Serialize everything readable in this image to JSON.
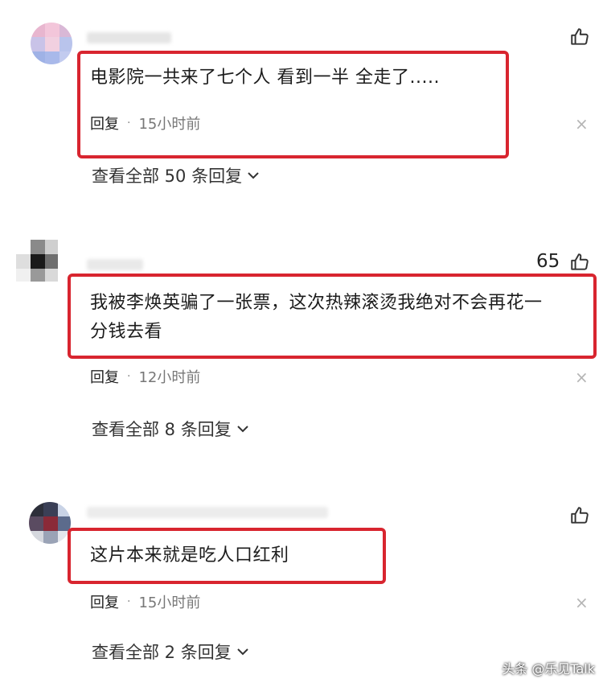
{
  "comments": [
    {
      "text": "电影院一共来了七个人 看到一半 全走了.....",
      "reply_label": "回复",
      "separator": "·",
      "time": "15小时前",
      "view_replies": "查看全部 50 条回复",
      "likes": "",
      "close": "×"
    },
    {
      "text_line1": "我被李焕英骗了一张票，这次热辣滚烫我绝对不会再花一",
      "text_line2": "分钱去看",
      "reply_label": "回复",
      "separator": "·",
      "time": "12小时前",
      "view_replies": "查看全部 8 条回复",
      "likes": "65",
      "close": "×"
    },
    {
      "text": "这片本来就是吃人口红利",
      "reply_label": "回复",
      "separator": "·",
      "time": "15小时前",
      "view_replies": "查看全部 2 条回复",
      "likes": "",
      "close": "×"
    }
  ],
  "watermark": "头条 @乐见Talk",
  "icons": {
    "like": "thumbs-up-icon",
    "chevron": "chevron-down-icon",
    "close": "close-icon"
  },
  "colors": {
    "highlight": "#d8252f"
  }
}
